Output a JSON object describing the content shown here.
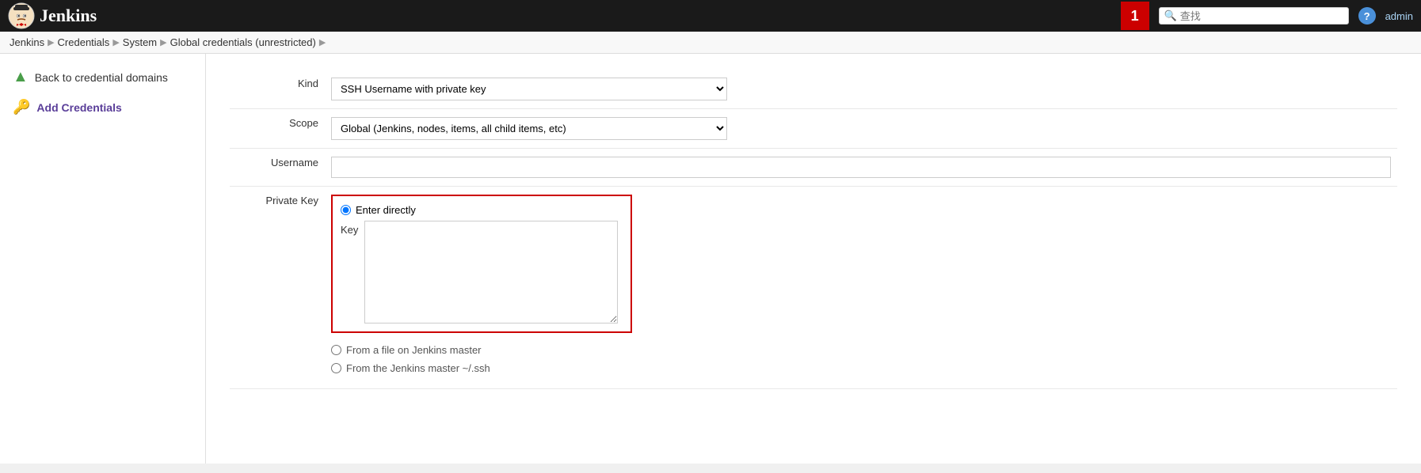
{
  "navbar": {
    "title": "Jenkins",
    "build_count": "1",
    "search_placeholder": "查找",
    "help_label": "?",
    "admin_label": "admin"
  },
  "breadcrumb": {
    "items": [
      {
        "label": "Jenkins",
        "href": "#"
      },
      {
        "label": "Credentials",
        "href": "#"
      },
      {
        "label": "System",
        "href": "#"
      },
      {
        "label": "Global credentials (unrestricted)",
        "href": "#"
      }
    ],
    "arrow": "▶"
  },
  "sidebar": {
    "back_label": "Back to credential domains",
    "add_label": "Add Credentials",
    "back_icon": "▲",
    "add_icon": "🔑"
  },
  "form": {
    "kind_label": "Kind",
    "kind_value": "SSH Username with private key",
    "scope_label": "Scope",
    "scope_value": "Global (Jenkins, nodes, items, all child items, etc)",
    "username_label": "Username",
    "username_value": "",
    "private_key_label": "Private Key",
    "enter_directly_label": "Enter directly",
    "key_label": "Key",
    "from_file_label": "From a file on Jenkins master",
    "from_ssh_label": "From the Jenkins master ~/.ssh"
  }
}
